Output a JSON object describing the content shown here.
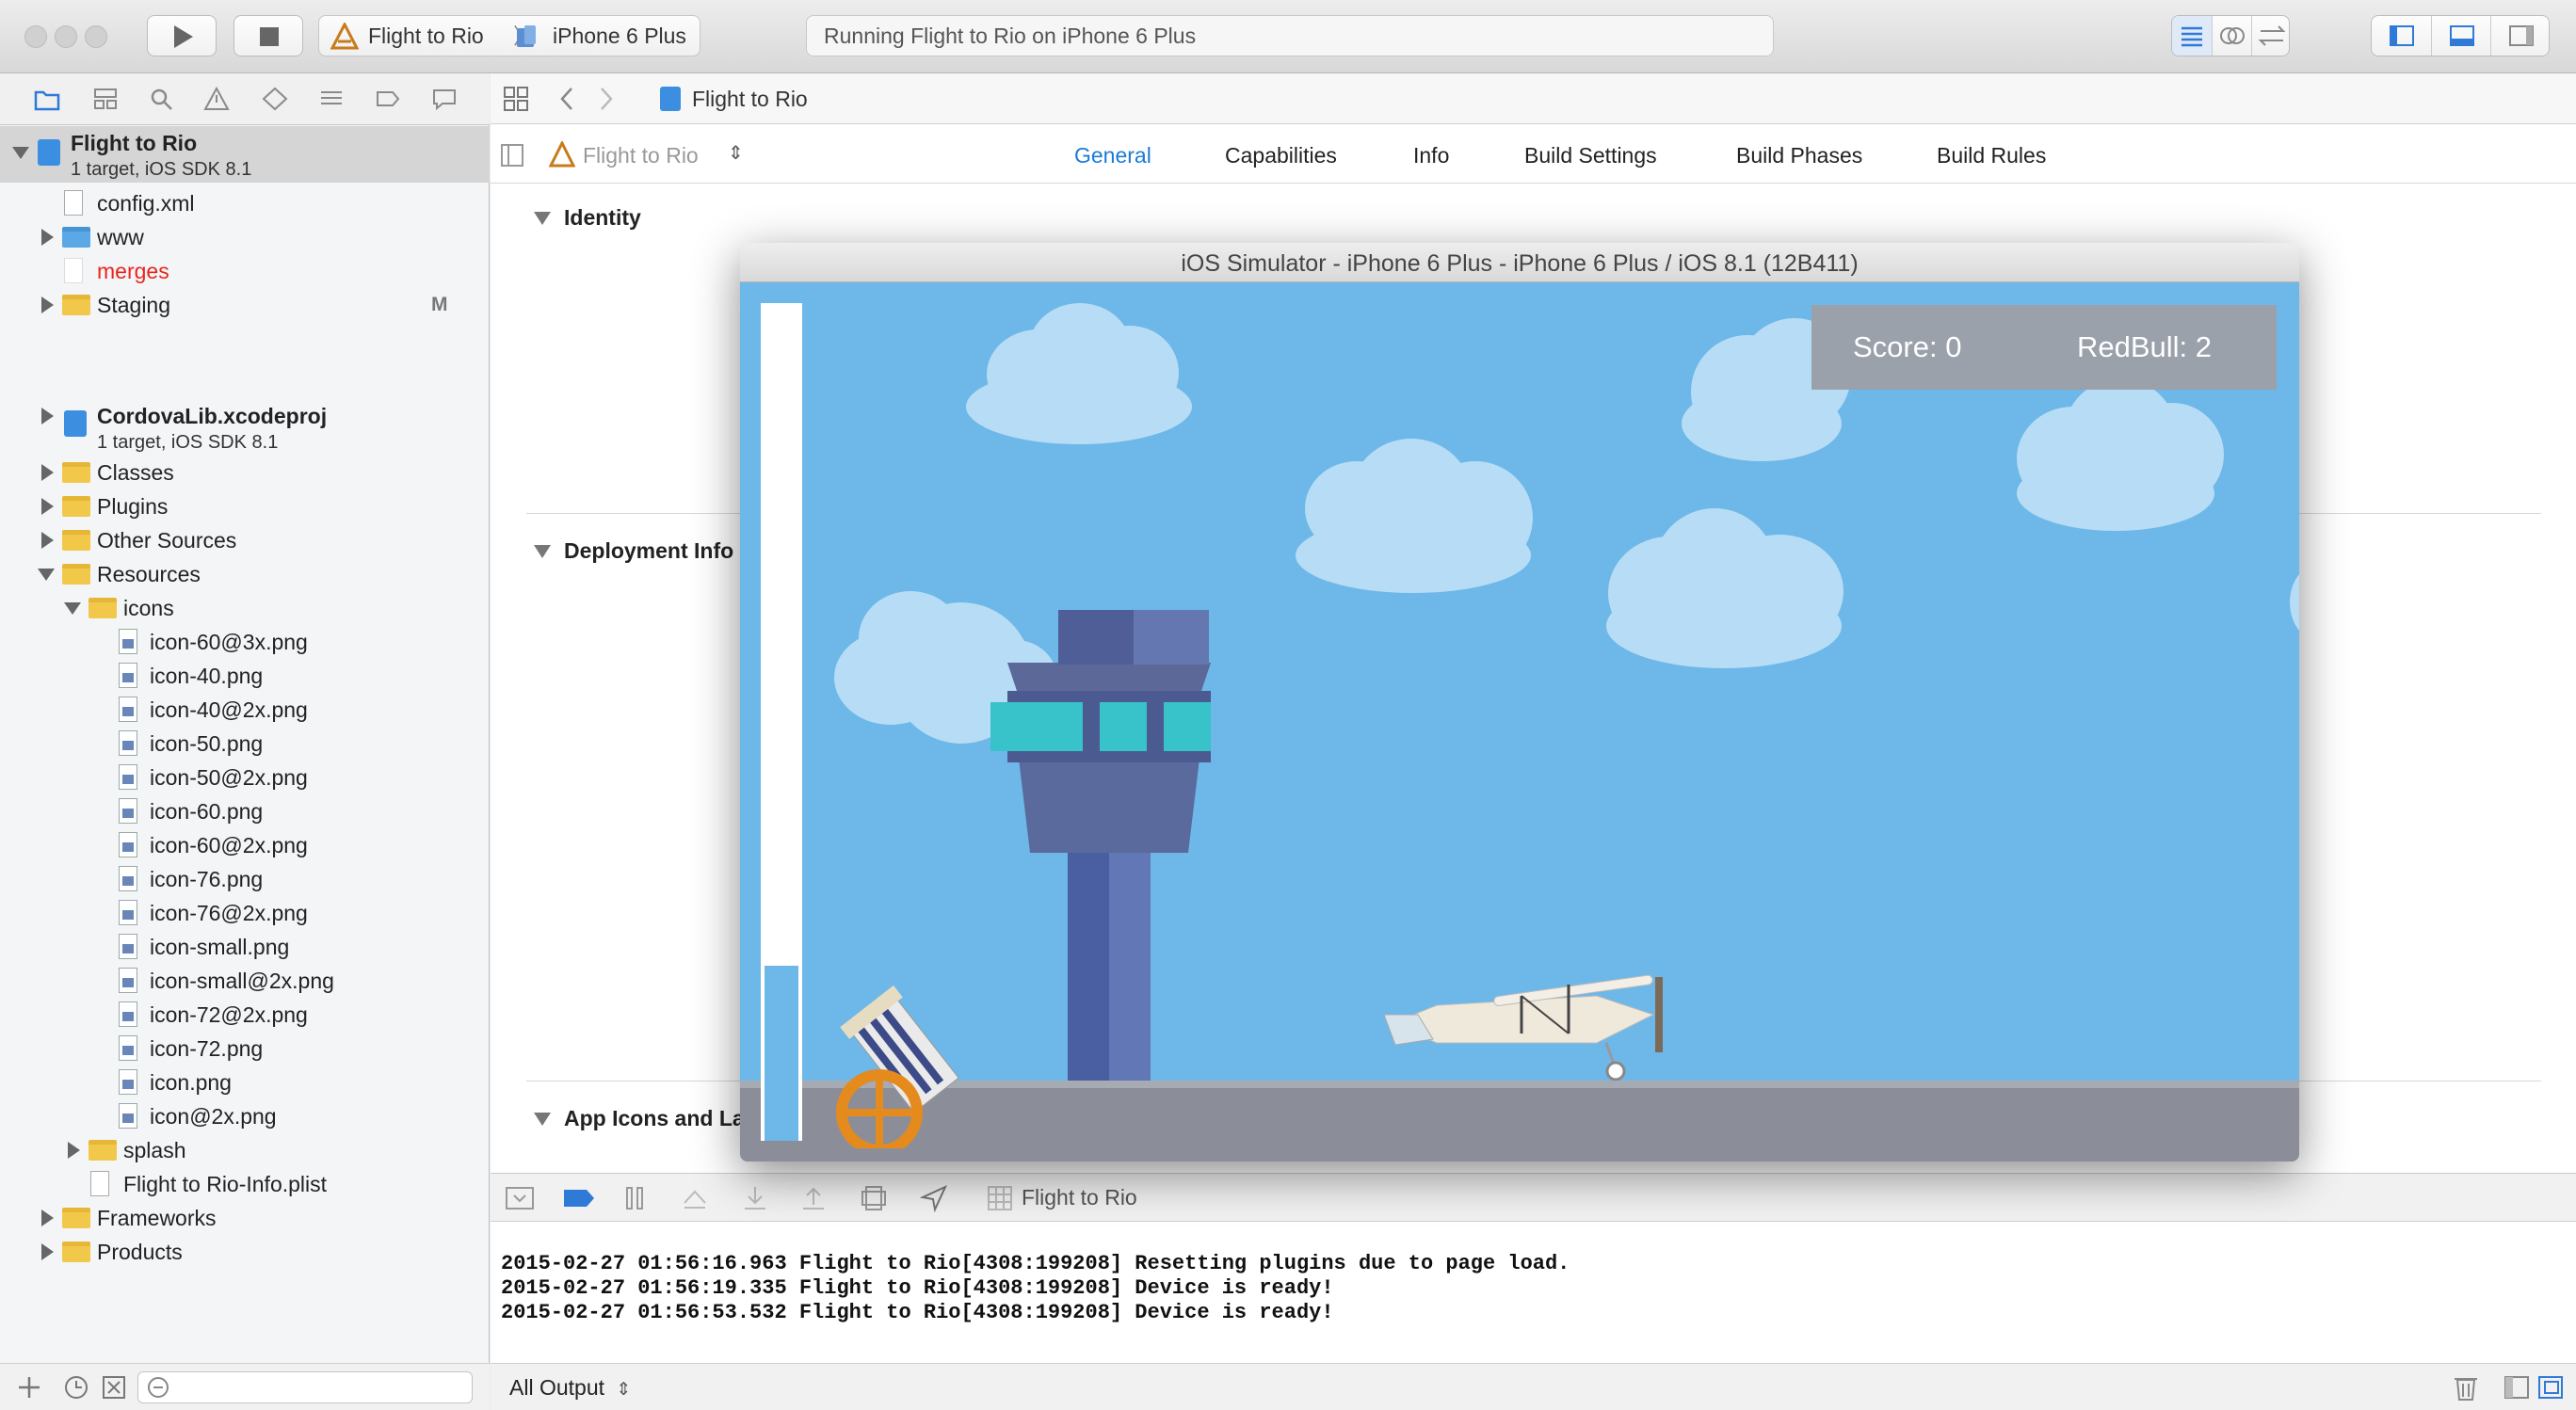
{
  "toolbar": {
    "scheme_target": "Flight to Rio",
    "scheme_separator": "〉",
    "scheme_device": "iPhone 6 Plus",
    "activity_status": "Running Flight to Rio on iPhone 6 Plus"
  },
  "navigator": {
    "project": {
      "name": "Flight to Rio",
      "detail": "1 target, iOS SDK 8.1"
    },
    "items": [
      {
        "label": "config.xml"
      },
      {
        "label": "www"
      },
      {
        "label": "merges"
      },
      {
        "label": "Staging",
        "badge": "M"
      },
      {
        "label": "CordovaLib.xcodeproj",
        "detail": "1 target, iOS SDK 8.1"
      },
      {
        "label": "Classes"
      },
      {
        "label": "Plugins"
      },
      {
        "label": "Other Sources"
      },
      {
        "label": "Resources"
      },
      {
        "label": "icons"
      },
      {
        "label": "icon-60@3x.png"
      },
      {
        "label": "icon-40.png"
      },
      {
        "label": "icon-40@2x.png"
      },
      {
        "label": "icon-50.png"
      },
      {
        "label": "icon-50@2x.png"
      },
      {
        "label": "icon-60.png"
      },
      {
        "label": "icon-60@2x.png"
      },
      {
        "label": "icon-76.png"
      },
      {
        "label": "icon-76@2x.png"
      },
      {
        "label": "icon-small.png"
      },
      {
        "label": "icon-small@2x.png"
      },
      {
        "label": "icon-72@2x.png"
      },
      {
        "label": "icon-72.png"
      },
      {
        "label": "icon.png"
      },
      {
        "label": "icon@2x.png"
      },
      {
        "label": "splash"
      },
      {
        "label": "Flight to Rio-Info.plist"
      },
      {
        "label": "Frameworks"
      },
      {
        "label": "Products"
      }
    ]
  },
  "editor": {
    "jump_bar": "Flight to Rio",
    "target_selector": "Flight to Rio",
    "tabs": [
      "General",
      "Capabilities",
      "Info",
      "Build Settings",
      "Build Phases",
      "Build Rules"
    ],
    "active_tab": "General",
    "sections": {
      "identity": "Identity",
      "deployment": "Deployment Info",
      "app_icons": "App Icons and La"
    }
  },
  "simulator": {
    "title": "iOS Simulator - iPhone 6 Plus - iPhone 6 Plus / iOS 8.1 (12B411)",
    "score": "Score: 0",
    "redbull": "RedBull: 2",
    "power_level": 0.21
  },
  "debug": {
    "breadcrumb": "Flight to Rio",
    "console_lines": [
      "2015-02-27 01:56:16.963 Flight to Rio[4308:199208] Resetting plugins due to page load.",
      "2015-02-27 01:56:19.335 Flight to Rio[4308:199208] Device is ready!",
      "2015-02-27 01:56:53.532 Flight to Rio[4308:199208] Device is ready!"
    ],
    "output_selector": "All Output"
  },
  "colors": {
    "accent": "#1b7bd6",
    "sky": "#6db8e8",
    "warning_red": "#e8251f"
  }
}
